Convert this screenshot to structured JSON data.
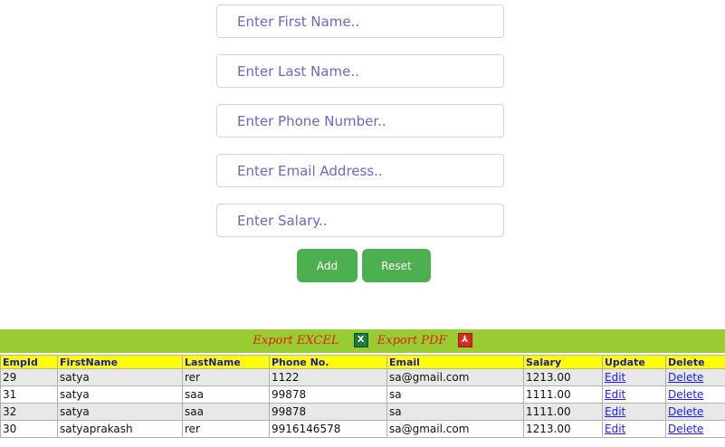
{
  "form": {
    "first_name_placeholder": "Enter First Name..",
    "last_name_placeholder": "Enter Last Name..",
    "phone_placeholder": "Enter Phone Number..",
    "email_placeholder": "Enter Email Address..",
    "salary_placeholder": "Enter Salary..",
    "add_label": "Add",
    "reset_label": "Reset"
  },
  "export": {
    "excel_label": "Export EXCEL",
    "pdf_label": "Export PDF",
    "excel_icon": "excel-icon",
    "pdf_icon": "pdf-icon"
  },
  "table": {
    "headers": [
      "EmpId",
      "FirstName",
      "LastName",
      "Phone No.",
      "Email",
      "Salary",
      "Update",
      "Delete"
    ],
    "rows": [
      {
        "empid": "29",
        "first": "satya",
        "last": "rer",
        "phone": "1122",
        "email": "sa@gmail.com",
        "salary": "1213.00",
        "update": "Edit",
        "delete": "Delete"
      },
      {
        "empid": "31",
        "first": "satya",
        "last": "saa",
        "phone": "99878",
        "email": "sa",
        "salary": "1111.00",
        "update": "Edit",
        "delete": "Delete"
      },
      {
        "empid": "32",
        "first": "satya",
        "last": "saa",
        "phone": "99878",
        "email": "sa",
        "salary": "1111.00",
        "update": "Edit",
        "delete": "Delete"
      },
      {
        "empid": "30",
        "first": "satyaprakash",
        "last": "rer",
        "phone": "9916146578",
        "email": "sa@gmail.com",
        "salary": "1213.00",
        "update": "Edit",
        "delete": "Delete"
      }
    ]
  },
  "colors": {
    "button_green": "#4caf50",
    "export_bar": "#99cc33",
    "header_yellow": "#ffff00",
    "export_link": "#e0200a"
  }
}
